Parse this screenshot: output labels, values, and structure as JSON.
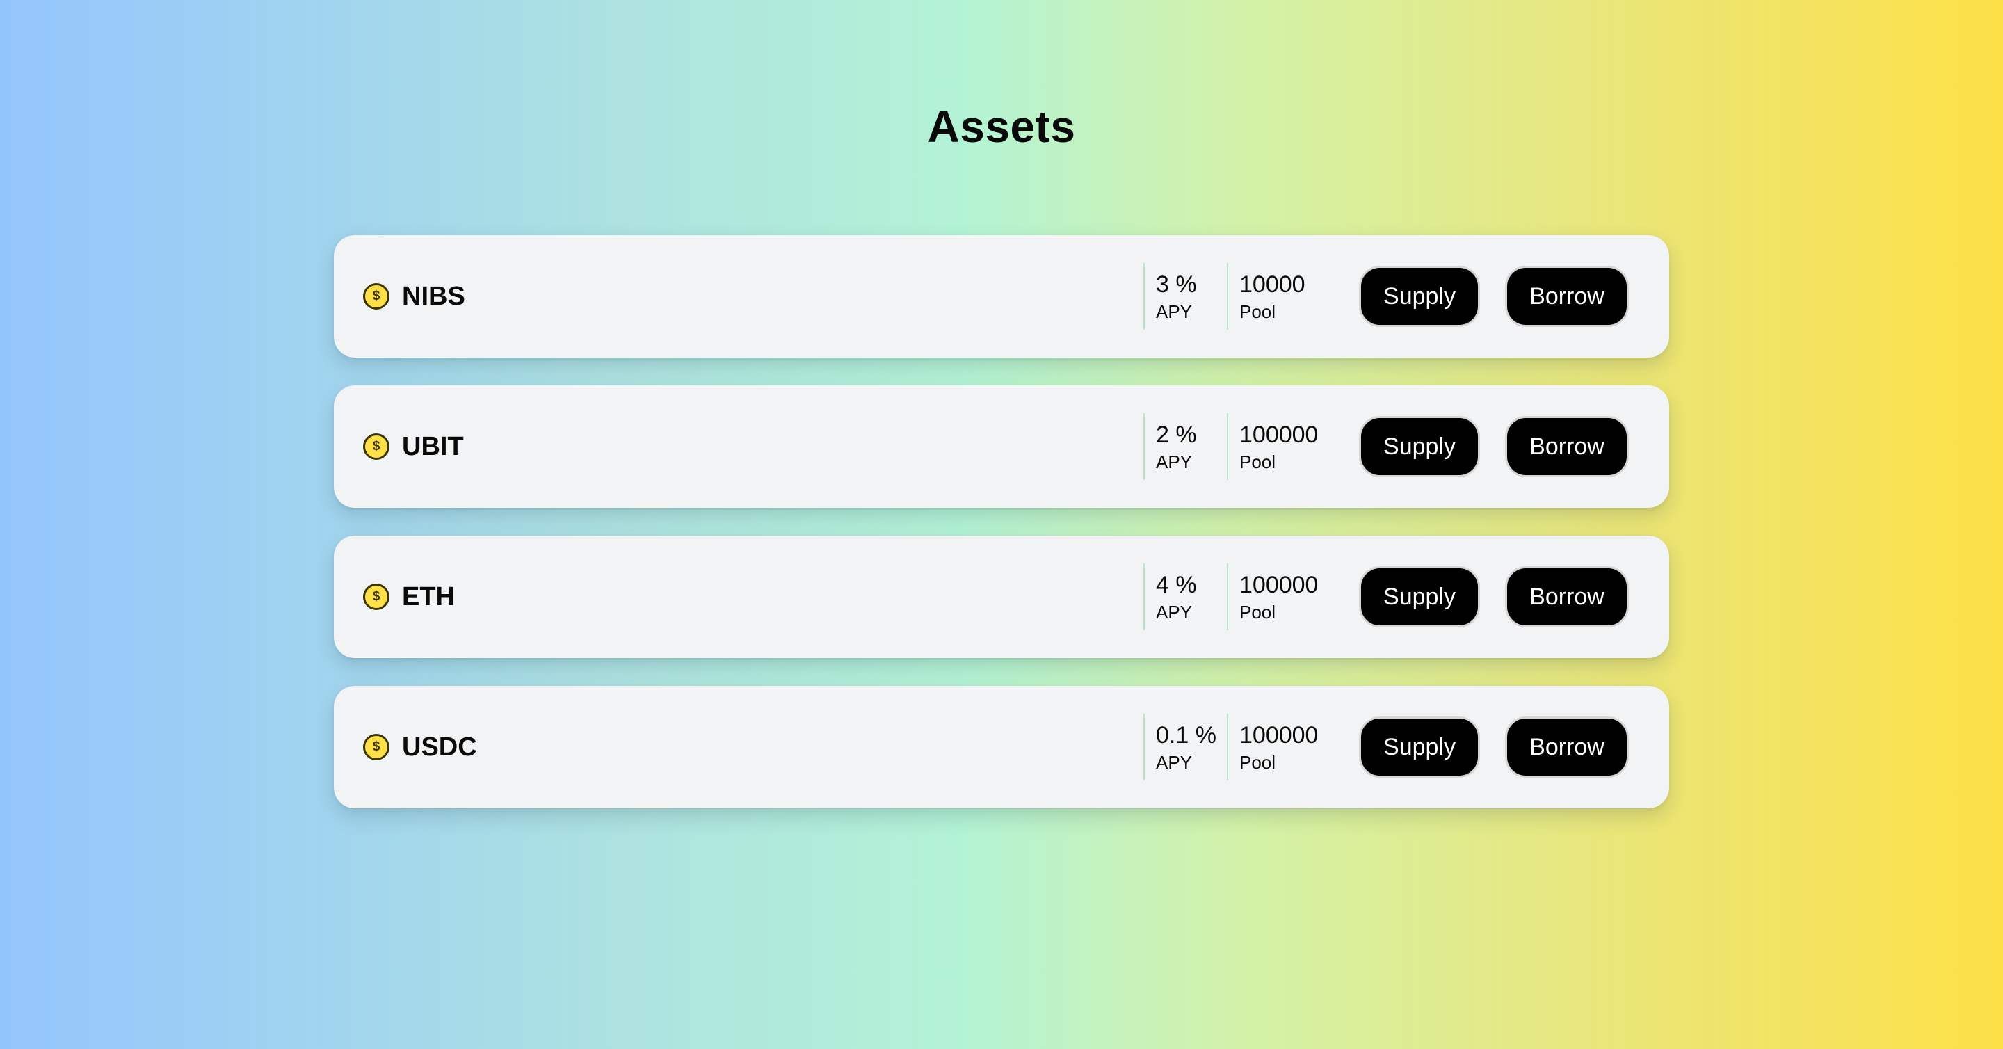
{
  "page": {
    "title": "Assets"
  },
  "assets": [
    {
      "symbol": "NIBS",
      "icon": "dollar-coin-icon",
      "apy": "3 %",
      "apy_label": "APY",
      "pool": "10000",
      "pool_label": "Pool",
      "supply_label": "Supply",
      "borrow_label": "Borrow"
    },
    {
      "symbol": "UBIT",
      "icon": "dollar-coin-icon",
      "apy": "2 %",
      "apy_label": "APY",
      "pool": "100000",
      "pool_label": "Pool",
      "supply_label": "Supply",
      "borrow_label": "Borrow"
    },
    {
      "symbol": "ETH",
      "icon": "dollar-coin-icon",
      "apy": "4 %",
      "apy_label": "APY",
      "pool": "100000",
      "pool_label": "Pool",
      "supply_label": "Supply",
      "borrow_label": "Borrow"
    },
    {
      "symbol": "USDC",
      "icon": "dollar-coin-icon",
      "apy": "0.1 %",
      "apy_label": "APY",
      "pool": "100000",
      "pool_label": "Pool",
      "supply_label": "Supply",
      "borrow_label": "Borrow"
    }
  ],
  "colors": {
    "gradient": [
      "#93c5fd",
      "#b3f3d5",
      "#fde047"
    ],
    "card_background": "#f2f3f5",
    "button_background": "#000000",
    "button_text": "#ffffff",
    "coin": "#fde047",
    "divider": "#b9e3c6"
  }
}
